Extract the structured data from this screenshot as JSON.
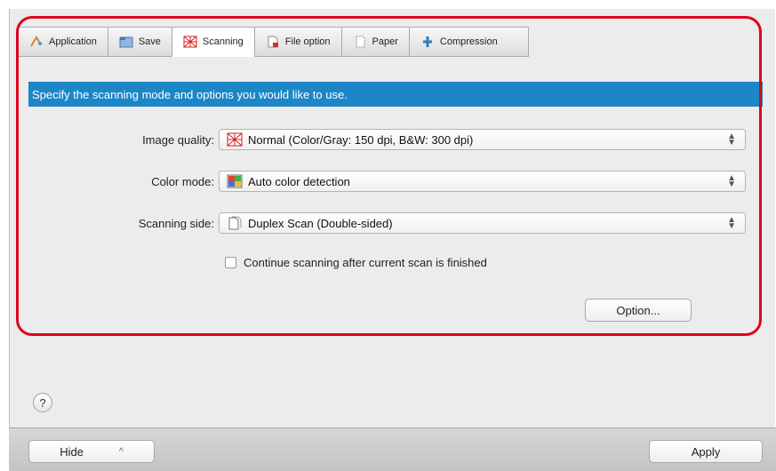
{
  "tabs": [
    {
      "label": "Application",
      "icon": "application-icon"
    },
    {
      "label": "Save",
      "icon": "save-icon"
    },
    {
      "label": "Scanning",
      "icon": "scanning-icon",
      "active": true
    },
    {
      "label": "File option",
      "icon": "file-option-icon"
    },
    {
      "label": "Paper",
      "icon": "paper-icon"
    },
    {
      "label": "Compression",
      "icon": "compression-icon"
    }
  ],
  "banner": "Specify the scanning mode and options you would like to use.",
  "fields": {
    "image_quality": {
      "label": "Image quality:",
      "value": "Normal (Color/Gray: 150 dpi, B&W: 300 dpi)"
    },
    "color_mode": {
      "label": "Color mode:",
      "value": "Auto color detection"
    },
    "scanning_side": {
      "label": "Scanning side:",
      "value": "Duplex Scan (Double-sided)"
    }
  },
  "checkbox": {
    "label": "Continue scanning after current scan is finished",
    "checked": false
  },
  "buttons": {
    "option": "Option...",
    "hide": "Hide",
    "apply": "Apply",
    "help": "?"
  },
  "colors": {
    "banner": "#1c86c6",
    "highlight_outline": "#e0001b"
  }
}
